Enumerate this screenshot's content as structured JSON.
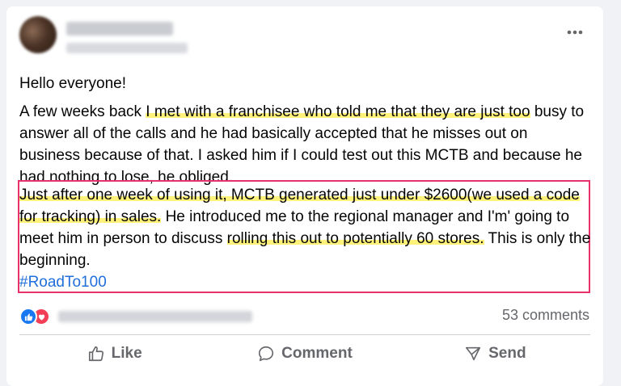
{
  "post": {
    "greeting": "Hello everyone!",
    "p1_a": "A few weeks back ",
    "p1_b": "I met with a franchisee who told me that they are just too",
    "p1_c": " busy to answer all of the calls and he had basically accepted that he misses out on business because of that.  I asked him if I could test out this MCTB and because he had nothing to lose, he obliged.",
    "p2_a": "Just after one week of using it, MCTB generated just under $2600(we used a code for tracking) in sales.",
    "p2_b": "  He introduced me to the regional manager and I'm' going to meet him in person to discuss ",
    "p2_c": "rolling this out to potentially 60 stores.",
    "p2_d": " This is only the beginning.",
    "hashtag": "#RoadTo100"
  },
  "footer": {
    "comments": "53 comments"
  },
  "actions": {
    "like": "Like",
    "comment": "Comment",
    "send": "Send"
  },
  "icons": {
    "more": "more-horizontal-icon",
    "like": "thumbs-up-icon",
    "comment": "comment-bubble-icon",
    "send": "send-icon",
    "reaction_like": "like-reaction-icon",
    "reaction_love": "love-reaction-icon"
  },
  "colors": {
    "highlight": "#fff27a",
    "box": "#e8306a",
    "link": "#216fdb",
    "like_blue": "#1877f2",
    "love_red": "#f33e58"
  }
}
